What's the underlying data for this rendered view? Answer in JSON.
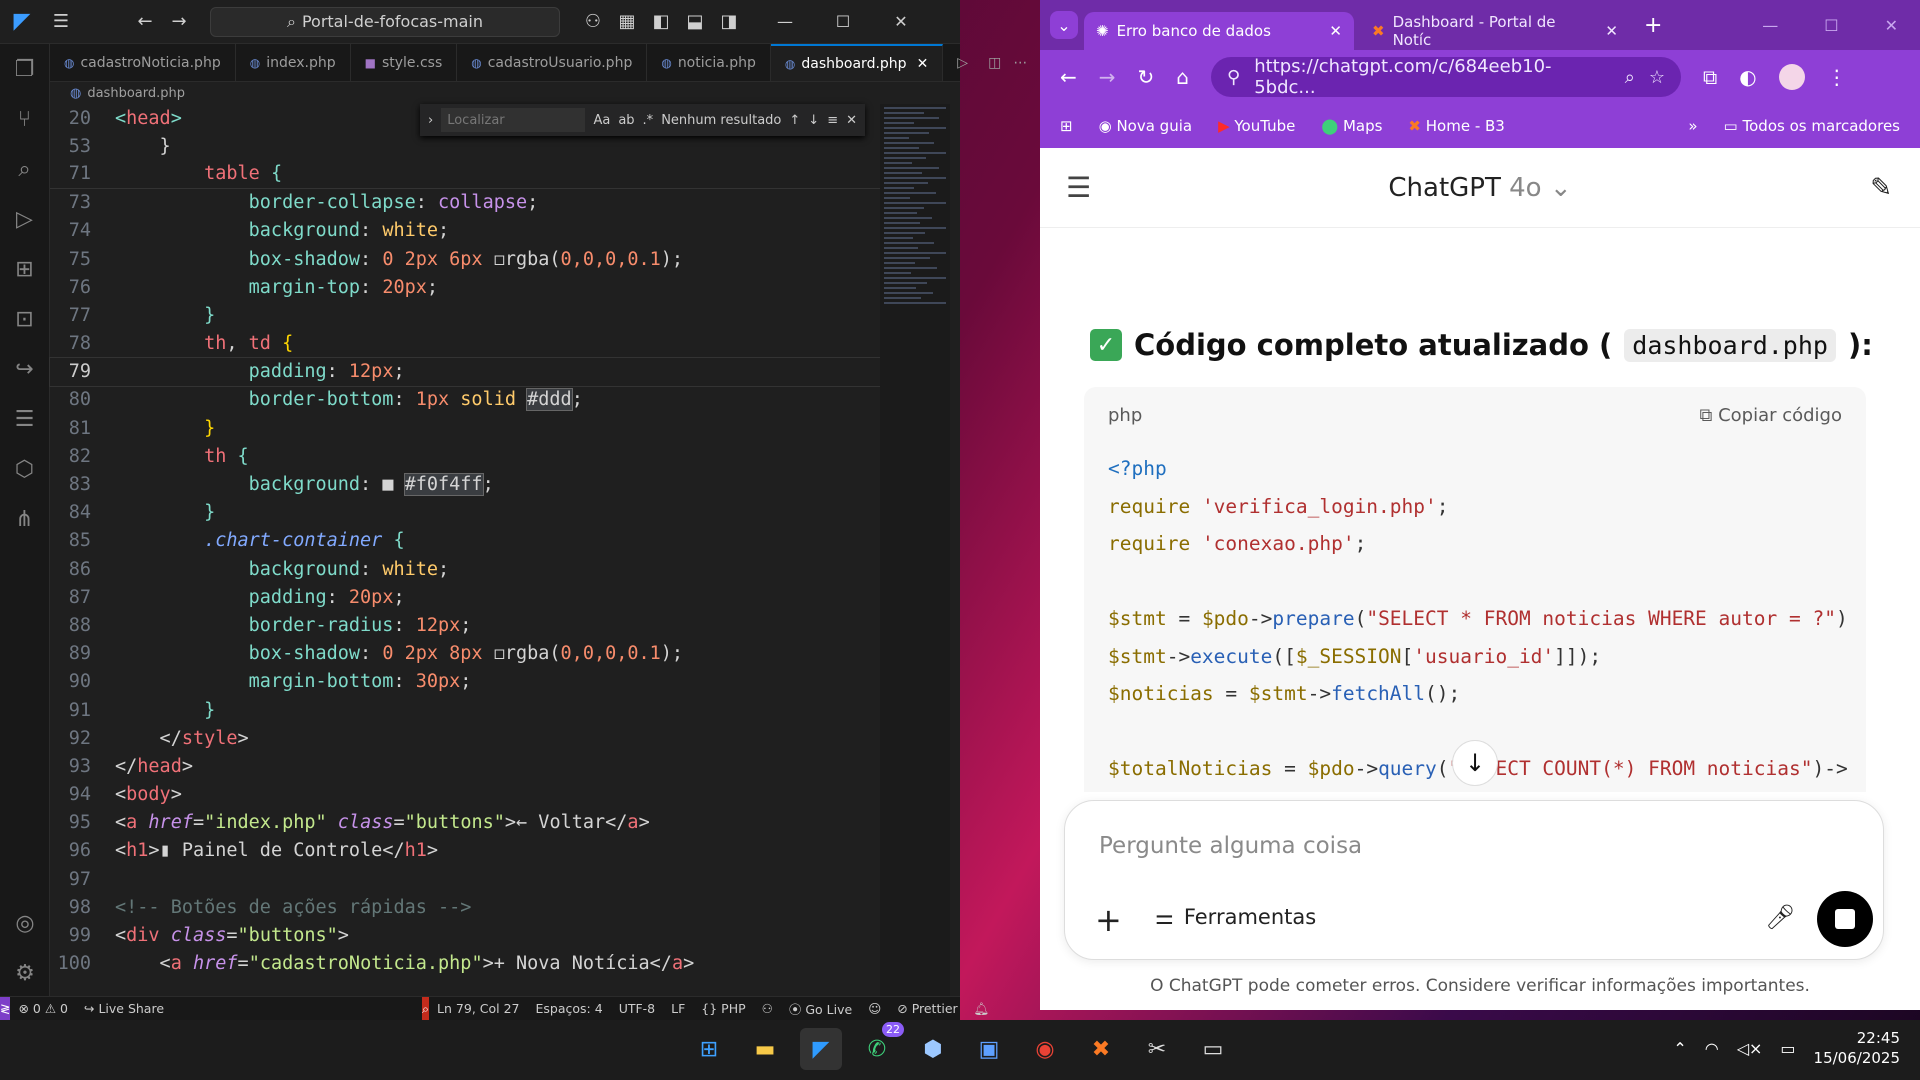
{
  "vscode": {
    "search": "Portal-de-fofocas-main",
    "tabs": [
      {
        "label": "cadastroNoticia.php"
      },
      {
        "label": "index.php"
      },
      {
        "label": "style.css"
      },
      {
        "label": "cadastroUsuario.php"
      },
      {
        "label": "noticia.php"
      },
      {
        "label": "dashboard.php"
      }
    ],
    "breadcrumb": "dashboard.php",
    "find": {
      "placeholder": "Localizar",
      "result": "Nenhum resultado",
      "opt1": "Aa",
      "opt2": "ab",
      "opt3": ".*"
    },
    "status": {
      "problems": "⊗ 0 ⚠ 0",
      "liveshare": "Live Share",
      "position": "Ln 79, Col 27",
      "spaces": "Espaços: 4",
      "encoding": "UTF-8",
      "eol": "LF",
      "language": "{} PHP",
      "golive": "Go Live",
      "prettier": "Prettier"
    }
  },
  "chrome": {
    "tabs": [
      {
        "title": "Erro banco de dados"
      },
      {
        "title": "Dashboard - Portal de Notíc"
      }
    ],
    "url": "https://chatgpt.com/c/684eeb10-5bdc...",
    "bookmarks": [
      "Nova guia",
      "YouTube",
      "Maps",
      "Home - B3"
    ],
    "all_bookmarks": "Todos os marcadores"
  },
  "chatgpt": {
    "title": "ChatGPT",
    "model": "4o",
    "heading": "Código completo atualizado (",
    "heading_code": "dashboard.php",
    "heading_end": "):",
    "code_lang": "php",
    "copy": "Copiar código",
    "placeholder": "Pergunte alguma coisa",
    "tools": "Ferramentas",
    "disclaimer": "O ChatGPT pode cometer erros. Considere verificar informações importantes."
  },
  "taskbar": {
    "whatsapp_badge": "22",
    "time": "22:45",
    "date": "15/06/2025"
  },
  "colors": {
    "vscode_bg": "#1f1f1f",
    "chrome_purple": "#8e3fd6",
    "accent": "#0078d4"
  }
}
